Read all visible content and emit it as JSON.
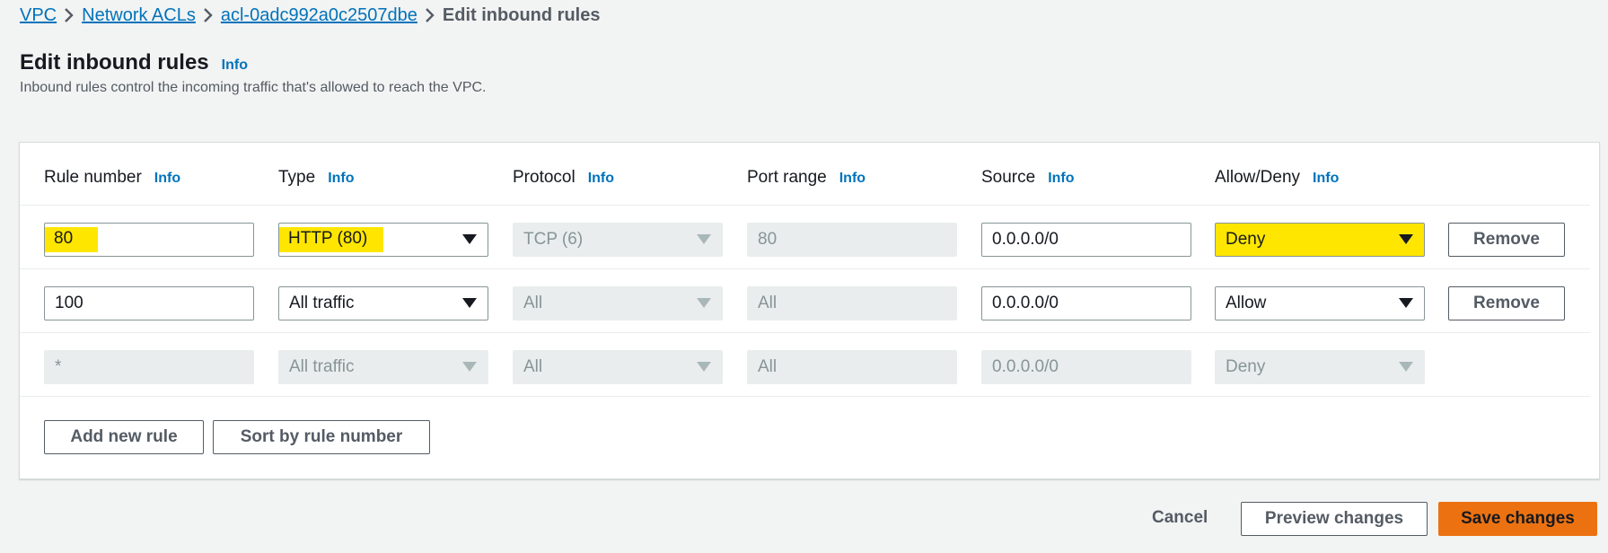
{
  "breadcrumb": {
    "vpc": "VPC",
    "network_acls": "Network ACLs",
    "acl_id": "acl-0adc992a0c2507dbe",
    "current": "Edit inbound rules"
  },
  "header": {
    "title": "Edit inbound rules",
    "info": "Info",
    "description": "Inbound rules control the incoming traffic that's allowed to reach the VPC."
  },
  "columns": [
    {
      "label": "Rule number",
      "info": "Info"
    },
    {
      "label": "Type",
      "info": "Info"
    },
    {
      "label": "Protocol",
      "info": "Info"
    },
    {
      "label": "Port range",
      "info": "Info"
    },
    {
      "label": "Source",
      "info": "Info"
    },
    {
      "label": "Allow/Deny",
      "info": "Info"
    }
  ],
  "rows": [
    {
      "rule_number": "80",
      "type": "HTTP (80)",
      "protocol": "TCP (6)",
      "port_range": "80",
      "source": "0.0.0.0/0",
      "action": "Deny",
      "remove": "Remove"
    },
    {
      "rule_number": "100",
      "type": "All traffic",
      "protocol": "All",
      "port_range": "All",
      "source": "0.0.0.0/0",
      "action": "Allow",
      "remove": "Remove"
    },
    {
      "rule_number": "*",
      "type": "All traffic",
      "protocol": "All",
      "port_range": "All",
      "source": "0.0.0.0/0",
      "action": "Deny"
    }
  ],
  "buttons": {
    "add_rule": "Add new rule",
    "sort": "Sort by rule number",
    "cancel": "Cancel",
    "preview": "Preview changes",
    "save": "Save changes"
  },
  "colors": {
    "link": "#0073bb",
    "highlight": "#ffe600",
    "primary": "#ec7211"
  },
  "icons": {
    "breadcrumb_separator": "chevron-right-icon",
    "select_caret": "caret-down-icon"
  }
}
